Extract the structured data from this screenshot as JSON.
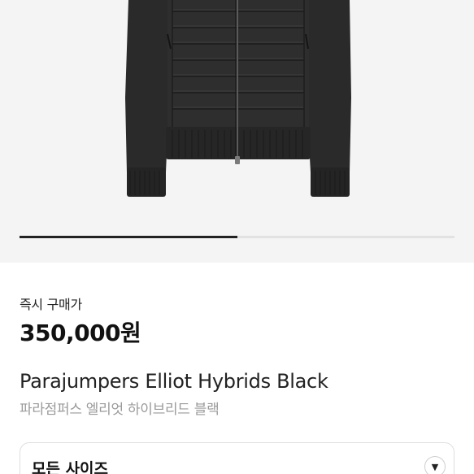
{
  "gallery": {
    "image_alt": "Parajumpers Elliot Hybrids Black jacket",
    "progress": 0.5
  },
  "price": {
    "label": "즉시 구매가",
    "value": "350,000원"
  },
  "product": {
    "name": "Parajumpers Elliot Hybrids Black",
    "name_ko": "파라점퍼스 엘리엇 하이브리드 블랙"
  },
  "size_select": {
    "label": "모든 사이즈",
    "icon": "chevron-down-icon"
  },
  "colors": {
    "background": "#f4f4f4",
    "progress_fill": "#222222",
    "progress_track": "#e2e2e2",
    "jacket": "#2b2b2b"
  }
}
